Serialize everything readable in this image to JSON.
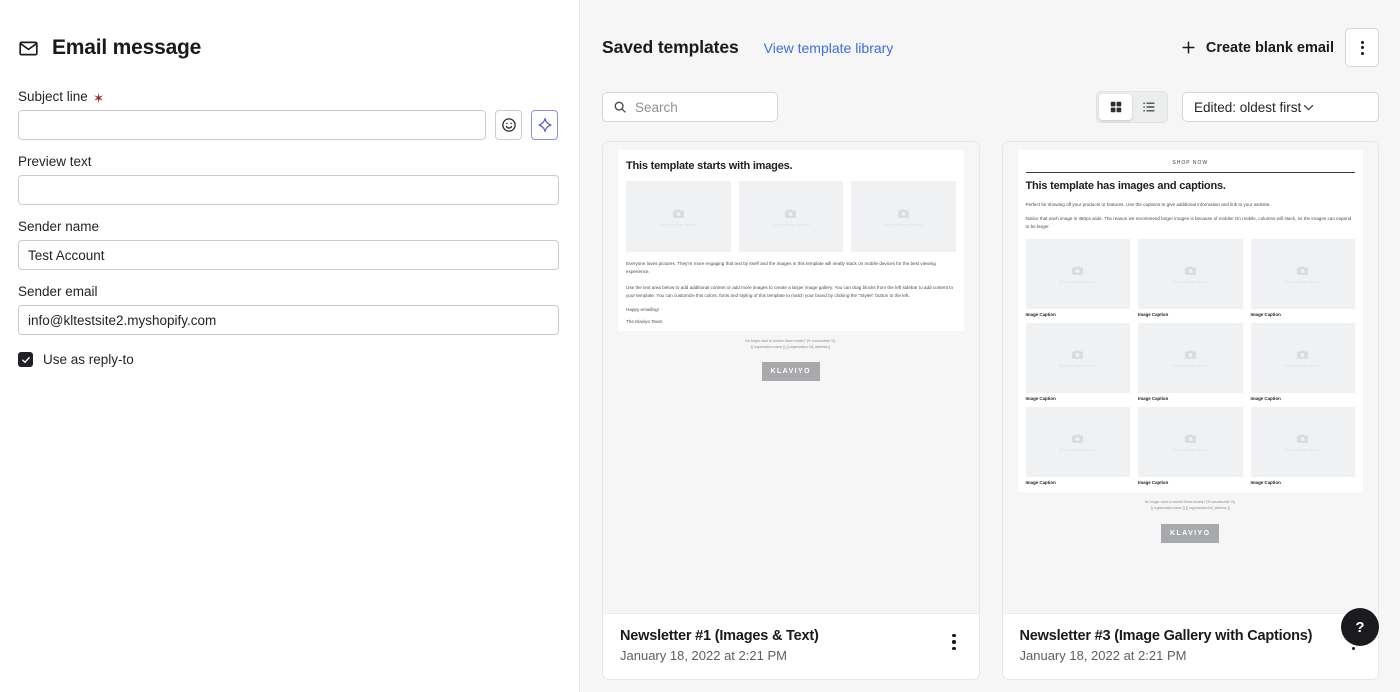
{
  "left": {
    "header_title": "Email message",
    "header_icon": "envelope-icon",
    "fields": {
      "subject": {
        "label": "Subject line",
        "required_marker": "✶",
        "value": "",
        "placeholder": ""
      },
      "preview": {
        "label": "Preview text",
        "value": "",
        "placeholder": ""
      },
      "sender_name": {
        "label": "Sender name",
        "value": "Test Account",
        "placeholder": ""
      },
      "sender_email": {
        "label": "Sender email",
        "value": "info@kltestsite2.myshopify.com",
        "placeholder": ""
      }
    },
    "subject_buttons": [
      {
        "icon": "emoji-smiley-icon",
        "accent": false
      },
      {
        "icon": "ai-sparkle-icon",
        "accent": true
      }
    ],
    "reply_to": {
      "label": "Use as reply-to",
      "checked": true
    }
  },
  "right": {
    "title": "Saved templates",
    "library_link": "View template library",
    "create_button": "Create blank email",
    "overflow_icon": "kebab-menu-icon",
    "search": {
      "placeholder": "Search",
      "value": ""
    },
    "view_modes": [
      {
        "name": "grid-view",
        "icon": "grid-icon",
        "active": true
      },
      {
        "name": "list-view",
        "icon": "list-icon",
        "active": false
      }
    ],
    "sort": {
      "selected": "Edited: oldest first"
    },
    "help_button": "?",
    "cards": [
      {
        "name": "Newsletter #1 (Images & Text)",
        "date": "January 18, 2022 at 2:21 PM",
        "preview": {
          "kind": "images-and-text",
          "heading": "This template starts with images.",
          "image_placeholder_text": "Drop an image file here",
          "image_count": 3,
          "paragraphs": [
            "Everyone loves pictures. They're more engaging that text by itself and the images in this template will neatly stack on mobile devices for the best viewing experience.",
            "Use the text area below to add additional content or add more images to create a larger image gallery. You can drag blocks from the left sidebar to add content to your template. You can customize this colors, fonts and styling of this template to match your brand by clicking the \"Styles\" button to the left."
          ],
          "signoff": [
            "Happy emailing!",
            "The Klaviyo Team"
          ],
          "unsubscribe": [
            "No longer want to receive these emails? {% unsubscribe %}.",
            "{{ organization.name }} {{ organization.full_address }}"
          ],
          "logo": "KLAVIYO"
        }
      },
      {
        "name": "Newsletter #3 (Image Gallery with Captions)",
        "date": "January 18, 2022 at 2:21 PM",
        "preview": {
          "kind": "image-gallery-with-captions",
          "shop_now": "SHOP NOW",
          "heading": "This template has images and captions.",
          "image_placeholder_text": "Drop an image file here",
          "caption": "Image Caption",
          "gallery_rows": 3,
          "gallery_cols": 3,
          "paragraphs": [
            "Perfect for showing off your products or features. Use the captions to give additional information and link to your website.",
            "Notice that each image is 450px wide. The reason we recommend larger images is because of mobile! On mobile, columns will stack, so the images can expand to be larger."
          ],
          "unsubscribe": [
            "No longer want to receive these emails? {% unsubscribe %}.",
            "{{ organization.name }} {{ organization.full_address }}"
          ],
          "logo": "KLAVIYO"
        }
      }
    ]
  },
  "colors": {
    "accent_link": "#3b6ede",
    "ai_accent": "#5c5ccc",
    "panel_bg": "#f6f6f7",
    "required_star": "#9b2c2c",
    "checkbox_on": "#1f2124"
  }
}
